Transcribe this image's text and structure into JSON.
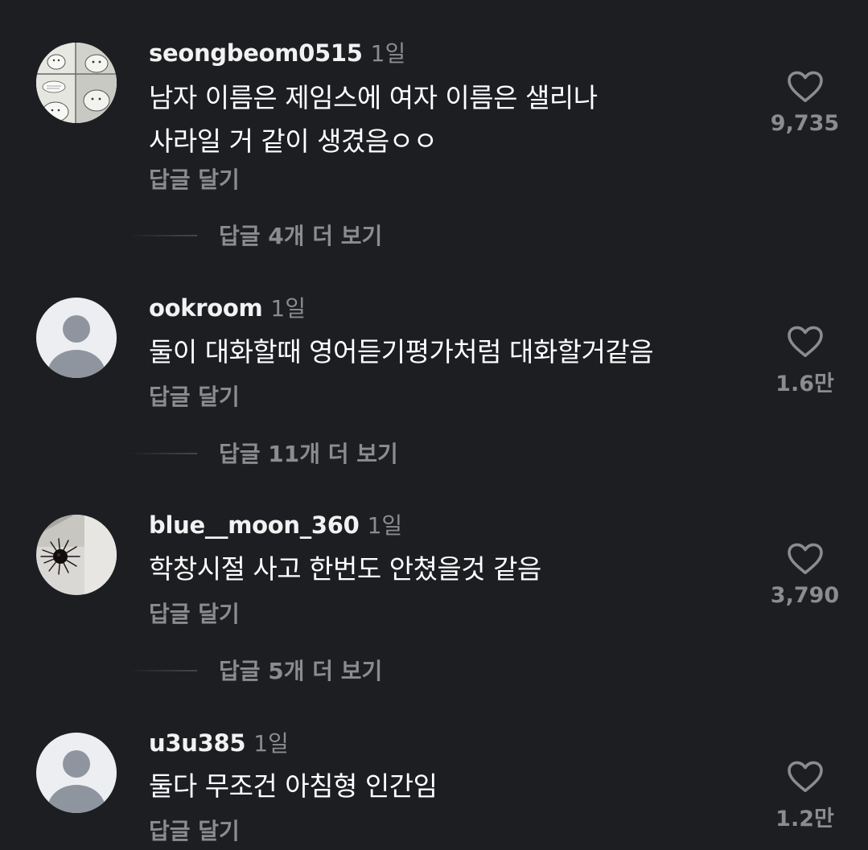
{
  "colors": {
    "background": "#1d1e22",
    "primary_text": "#ffffff",
    "secondary_text": "#8b8c90",
    "default_avatar_bg": "#eceef1",
    "default_avatar_fg": "#8f959e"
  },
  "comments": [
    {
      "username": "seongbeom0515",
      "time": "1일",
      "text_lines": [
        "남자 이름은 제임스에 여자 이름은 샐리나",
        "사라일 거 같이 생겼음ㅇㅇ"
      ],
      "reply_label": "답글 달기",
      "like_icon": "heart-outline-icon",
      "like_count": "9,735",
      "more_replies": "답글 4개 더 보기"
    },
    {
      "username": "ookroom",
      "time": "1일",
      "text_lines": [
        "둘이 대화할때 영어듣기평가처럼 대화할거같음"
      ],
      "reply_label": "답글 달기",
      "like_icon": "heart-outline-icon",
      "like_count": "1.6만",
      "more_replies": "답글 11개 더 보기"
    },
    {
      "username": "blue__moon_360",
      "time": "1일",
      "text_lines": [
        "학창시절 사고 한번도 안쳤을것 같음"
      ],
      "reply_label": "답글 달기",
      "like_icon": "heart-outline-icon",
      "like_count": "3,790",
      "more_replies": "답글 5개 더 보기"
    },
    {
      "username": "u3u385",
      "time": "1일",
      "text_lines": [
        "둘다 무조건 아침형 인간임"
      ],
      "reply_label": "답글 달기",
      "like_icon": "heart-outline-icon",
      "like_count": "1.2만"
    }
  ]
}
